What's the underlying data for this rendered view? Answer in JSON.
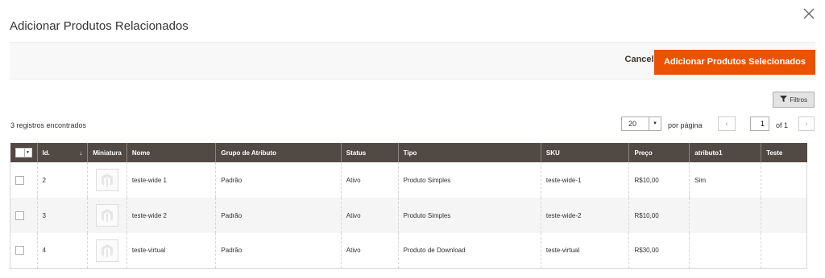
{
  "modal": {
    "title": "Adicionar Produtos Relacionados",
    "close_icon": "close-icon"
  },
  "actions": {
    "cancel_label": "Cancelar",
    "add_label": "Adicionar Produtos Selecionados",
    "accent_color": "#eb5202"
  },
  "toolbar": {
    "filters_label": "Filtros",
    "records_text": "3 registros encontrados",
    "per_page_value": "20",
    "per_page_label": "por página",
    "current_page": "1",
    "page_of": "of 1"
  },
  "table": {
    "headers": {
      "id": "Id.",
      "thumbnail": "Miniatura",
      "name": "Nome",
      "attribute_set": "Grupo de Atributo",
      "status": "Status",
      "type": "Tipo",
      "sku": "SKU",
      "price": "Preço",
      "attr1": "atributo1",
      "test": "Teste"
    },
    "sort_indicator": "↓",
    "rows": [
      {
        "id": "2",
        "name": "teste-wide 1",
        "attribute_set": "Padrão",
        "status": "Ativo",
        "type": "Produto Simples",
        "sku": "teste-wide-1",
        "price": "R$10,00",
        "attr1": "Sim",
        "test": ""
      },
      {
        "id": "3",
        "name": "teste-wide 2",
        "attribute_set": "Padrão",
        "status": "Ativo",
        "type": "Produto Simples",
        "sku": "teste-wide-2",
        "price": "R$10,00",
        "attr1": "",
        "test": ""
      },
      {
        "id": "4",
        "name": "teste-virtual",
        "attribute_set": "Padrão",
        "status": "Ativo",
        "type": "Produto de Download",
        "sku": "teste-virtual",
        "price": "R$30,00",
        "attr1": "",
        "test": ""
      }
    ]
  }
}
